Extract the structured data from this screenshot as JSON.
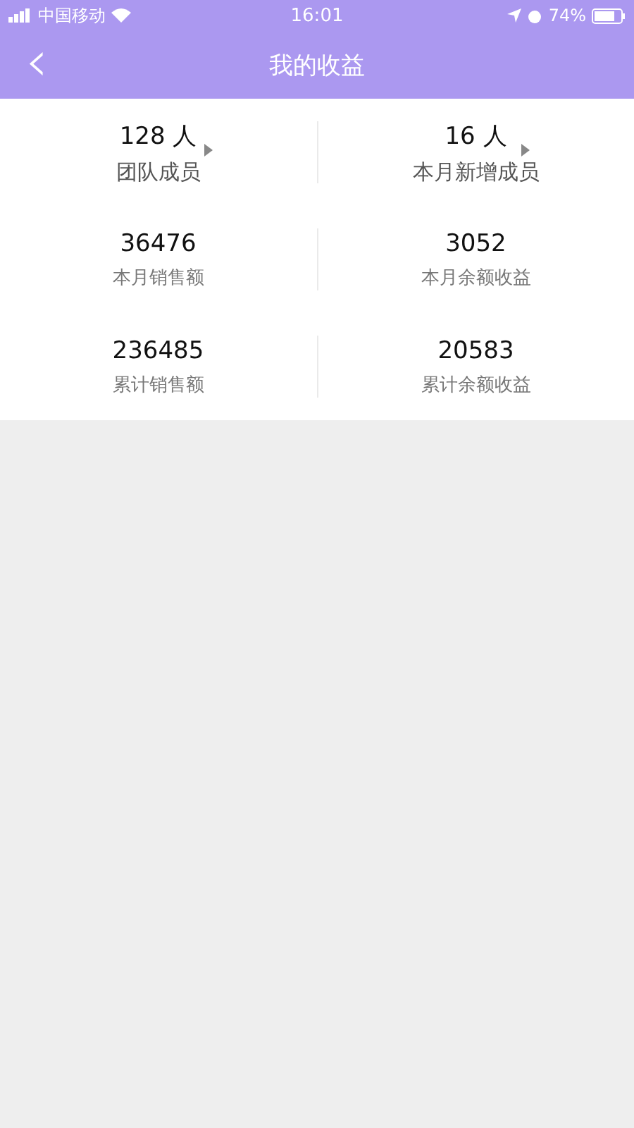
{
  "status_bar": {
    "carrier": "中国移动",
    "time": "16:01",
    "battery": "74%"
  },
  "nav": {
    "back": "‹",
    "title": "我的收益"
  },
  "stats": [
    [
      {
        "kind": "link",
        "value": "128 人",
        "label": "团队成员"
      },
      {
        "kind": "link",
        "value": "16 人",
        "label": "本月新增成员"
      }
    ],
    [
      {
        "kind": "plain",
        "value": "36476",
        "label": "本月销售额"
      },
      {
        "kind": "plain",
        "value": "3052",
        "label": "本月余额收益"
      }
    ],
    [
      {
        "kind": "plain",
        "value": "236485",
        "label": "累计销售额"
      },
      {
        "kind": "plain",
        "value": "20583",
        "label": "累计余额收益"
      }
    ]
  ]
}
